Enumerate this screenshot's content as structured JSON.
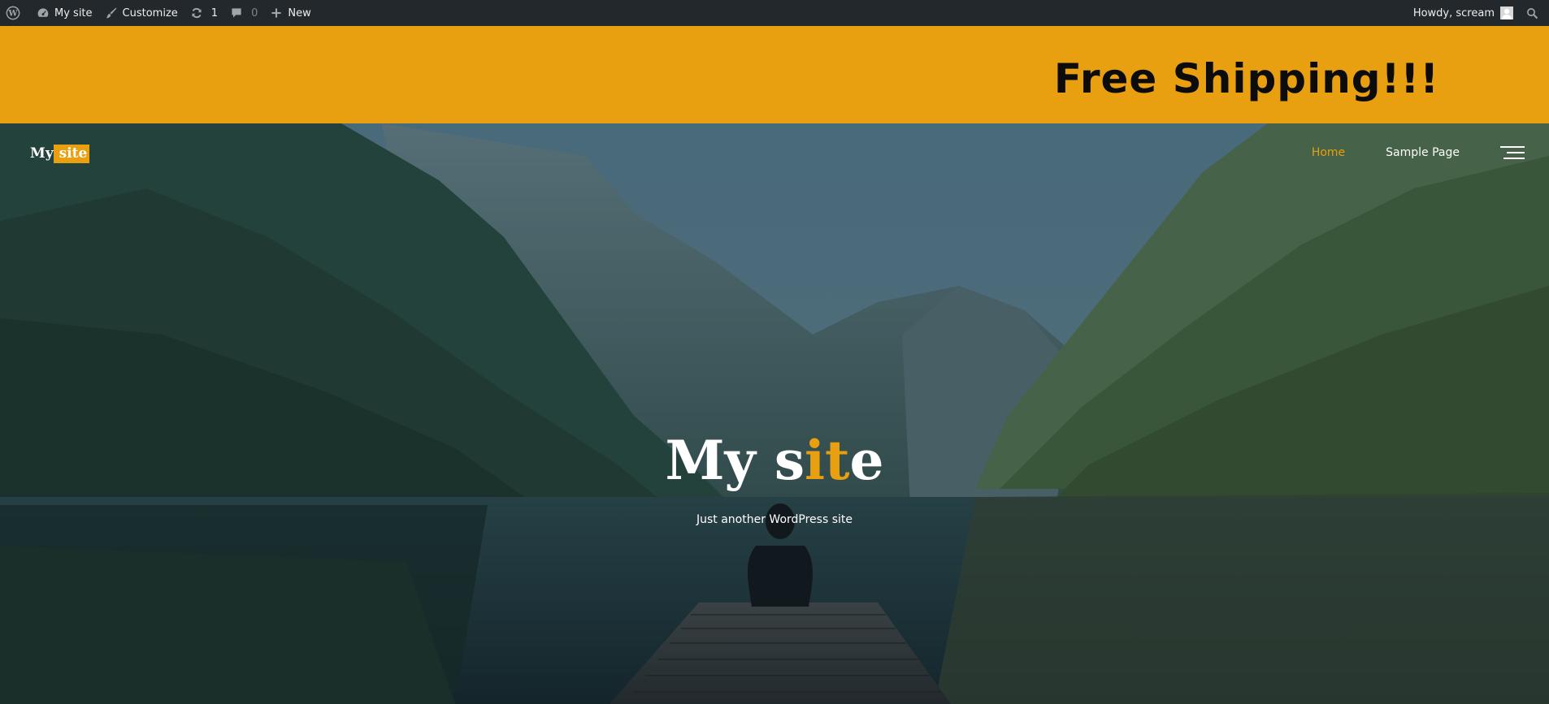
{
  "admin_bar": {
    "site_name": "My site",
    "customize": "Customize",
    "updates_count": "1",
    "comments_count": "0",
    "new_label": "New",
    "greeting": "Howdy, scream"
  },
  "banner": {
    "text": "Free Shipping!!!",
    "color": "#e8a010"
  },
  "header": {
    "logo_part1": "My",
    "logo_part2": " site",
    "nav": [
      {
        "label": "Home",
        "active": true
      },
      {
        "label": "Sample Page",
        "active": false
      }
    ]
  },
  "hero": {
    "title_part1": "My s",
    "title_accent": "it",
    "title_part2": "e",
    "tagline": "Just another WordPress site"
  },
  "colors": {
    "accent": "#e8a010",
    "admin_bar_bg": "#23282d"
  }
}
